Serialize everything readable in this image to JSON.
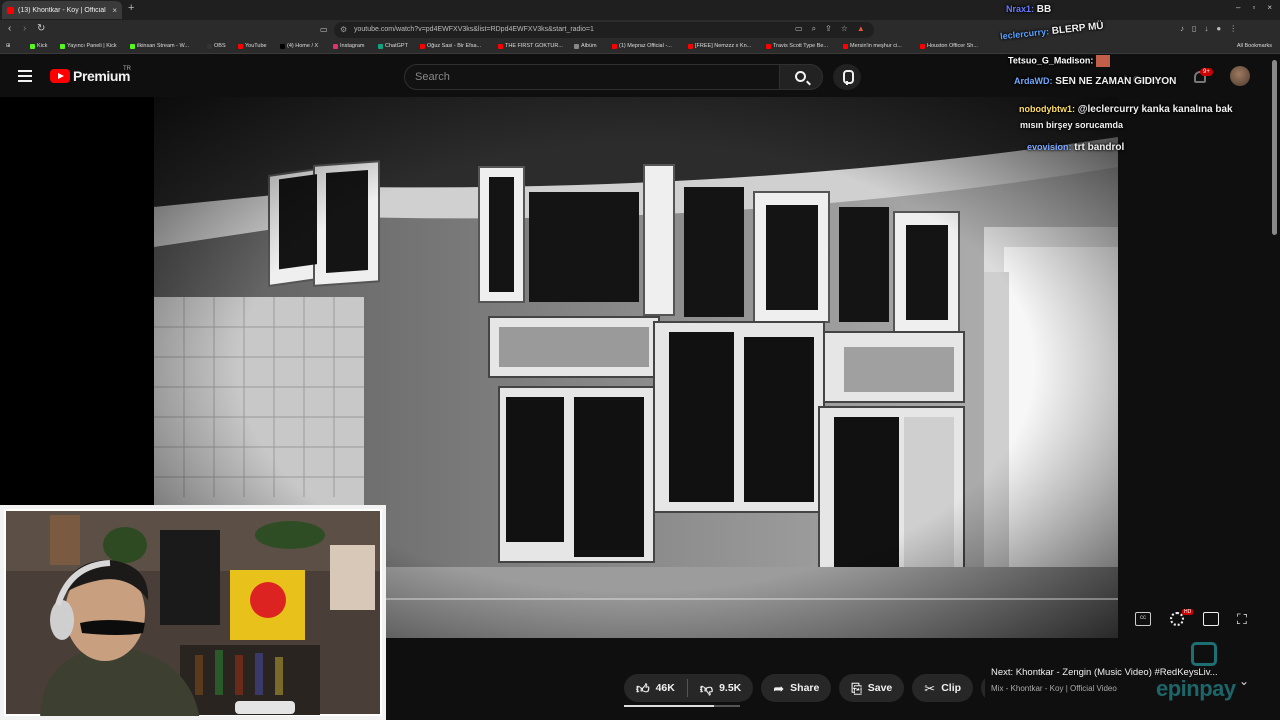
{
  "browser": {
    "tab_title": "(13) Khontkar - Koy | Official",
    "tab_close": "×",
    "new_tab": "+",
    "url": "youtube.com/watch?v=pd4EWFXV3ks&list=RDpd4EWFXV3ks&start_radio=1",
    "all_bookmarks": "All Bookmarks",
    "bookmarks": [
      {
        "label": "Kick",
        "color": "#53fc18"
      },
      {
        "label": "Yayıncı Paneli | Kick",
        "color": "#53fc18"
      },
      {
        "label": "ilkinsan Stream - W...",
        "color": "#53fc18"
      },
      {
        "label": "OBS",
        "color": "#333333"
      },
      {
        "label": "YouTube",
        "color": "#ff0000"
      },
      {
        "label": "(4) Home / X",
        "color": "#000000"
      },
      {
        "label": "Instagram",
        "color": "#e1306c"
      },
      {
        "label": "ChatGPT",
        "color": "#10a37f"
      },
      {
        "label": "Oğuz Sasi - Bir Efsa...",
        "color": "#ff0000"
      },
      {
        "label": "THE FIRST GOKTUR...",
        "color": "#ff0000"
      },
      {
        "label": "Albüm",
        "color": "#888888"
      },
      {
        "label": "(1) Mepraz Official -...",
        "color": "#ff0000"
      },
      {
        "label": "[FREE] Nemzzz x Kn...",
        "color": "#ff0000"
      },
      {
        "label": "Travis Scott Type Be...",
        "color": "#ff0000"
      },
      {
        "label": "Mersin'in meşhur ci...",
        "color": "#ff0000"
      },
      {
        "label": "Houston Officer Sh...",
        "color": "#ff0000"
      }
    ]
  },
  "youtube": {
    "logo_text": "Premium",
    "country": "TR",
    "search_placeholder": "Search",
    "create_label": "Create",
    "notif_count": "9+"
  },
  "video": {
    "progress": 0.0
  },
  "actions": {
    "likes": "46K",
    "dislikes": "9.5K",
    "share": "Share",
    "save": "Save",
    "clip": "Clip",
    "more": "⋯"
  },
  "next_video": {
    "title": "Next: Khontkar - Zengin (Music Video) #RedKeysLiv...",
    "subtitle": "Mix - Khontkar - Koy | Official Video"
  },
  "sponsor": {
    "name": "epinpay"
  },
  "chat": [
    {
      "user": "Nrax1:",
      "msg": "BB",
      "color": "#6a7bff"
    },
    {
      "user": "leclercurry:",
      "msg": "BLERP MÜ",
      "color": "#5aa0ff"
    },
    {
      "user": "Tetsuo_G_Madison:",
      "msg": "",
      "color": "#ffffff"
    },
    {
      "user": "ArdaWD:",
      "msg": "SEN NE ZAMAN GIDIYON",
      "color": "#6fa8ff"
    },
    {
      "user": "nobodybtw1:",
      "msg": "@leclercurry kanka kanalına bak",
      "color": "#ffdd66"
    },
    {
      "user": "",
      "msg": "mısın birşey sorucamda",
      "color": "#ffffff"
    },
    {
      "user": "evovision:",
      "msg": "trt bandrol",
      "color": "#7aa8ff"
    }
  ]
}
